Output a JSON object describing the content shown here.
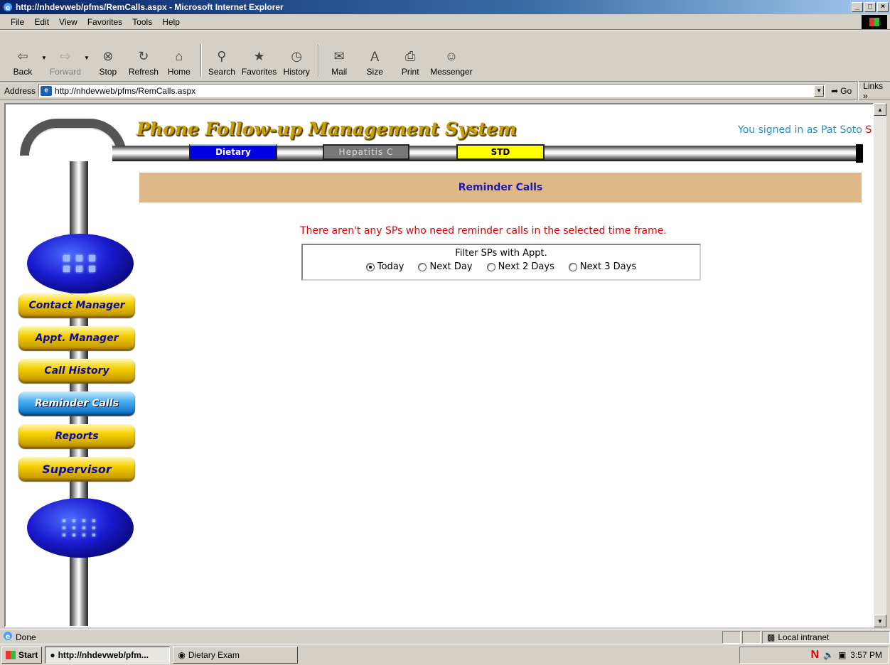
{
  "window": {
    "title": "http://nhdevweb/pfms/RemCalls.aspx - Microsoft Internet Explorer",
    "controls": [
      "_",
      "□",
      "×"
    ]
  },
  "menu": [
    "File",
    "Edit",
    "View",
    "Favorites",
    "Tools",
    "Help"
  ],
  "toolbar": {
    "back": "Back",
    "forward": "Forward",
    "stop": "Stop",
    "refresh": "Refresh",
    "home": "Home",
    "search": "Search",
    "favorites": "Favorites",
    "history": "History",
    "mail": "Mail",
    "size": "Size",
    "print": "Print",
    "messenger": "Messenger"
  },
  "address": {
    "label": "Address",
    "url": "http://nhdevweb/pfms/RemCalls.aspx",
    "go": "Go",
    "links": "Links »"
  },
  "page": {
    "app_title": "Phone Follow-up Management System",
    "signed_in_prefix": "You signed in as Pat Soto",
    "sign_out": "Sign Out",
    "tabs": {
      "dietary": "Dietary",
      "hepatitis": "Hepatitis C",
      "std": "STD"
    },
    "header": "Reminder Calls",
    "message": "There aren't any SPs who need reminder calls in the selected time frame.",
    "filter": {
      "title": "Filter SPs with Appt.",
      "options": [
        "Today",
        "Next Day",
        "Next 2 Days",
        "Next 3 Days"
      ],
      "selected": "Today"
    },
    "nav": {
      "contact_manager": "Contact Manager",
      "appt_manager": "Appt. Manager",
      "call_history": "Call History",
      "reminder_calls": "Reminder Calls",
      "reports": "Reports",
      "supervisor": "Supervisor"
    },
    "active_nav": "Reminder Calls"
  },
  "status": {
    "text": "Done",
    "zone": "Local intranet"
  },
  "taskbar": {
    "start": "Start",
    "tasks": [
      "http://nhdevweb/pfm...",
      "Dietary Exam"
    ],
    "clock": "3:57 PM"
  },
  "colors": {
    "header_bg": "#deb887",
    "header_text": "#1a1ab0",
    "message": "#e00000",
    "signin": "#1e90d0",
    "signout": "#e00000",
    "dietary_tab": "#0000e0",
    "std_tab": "#ffff00",
    "hep_tab": "#777777"
  }
}
